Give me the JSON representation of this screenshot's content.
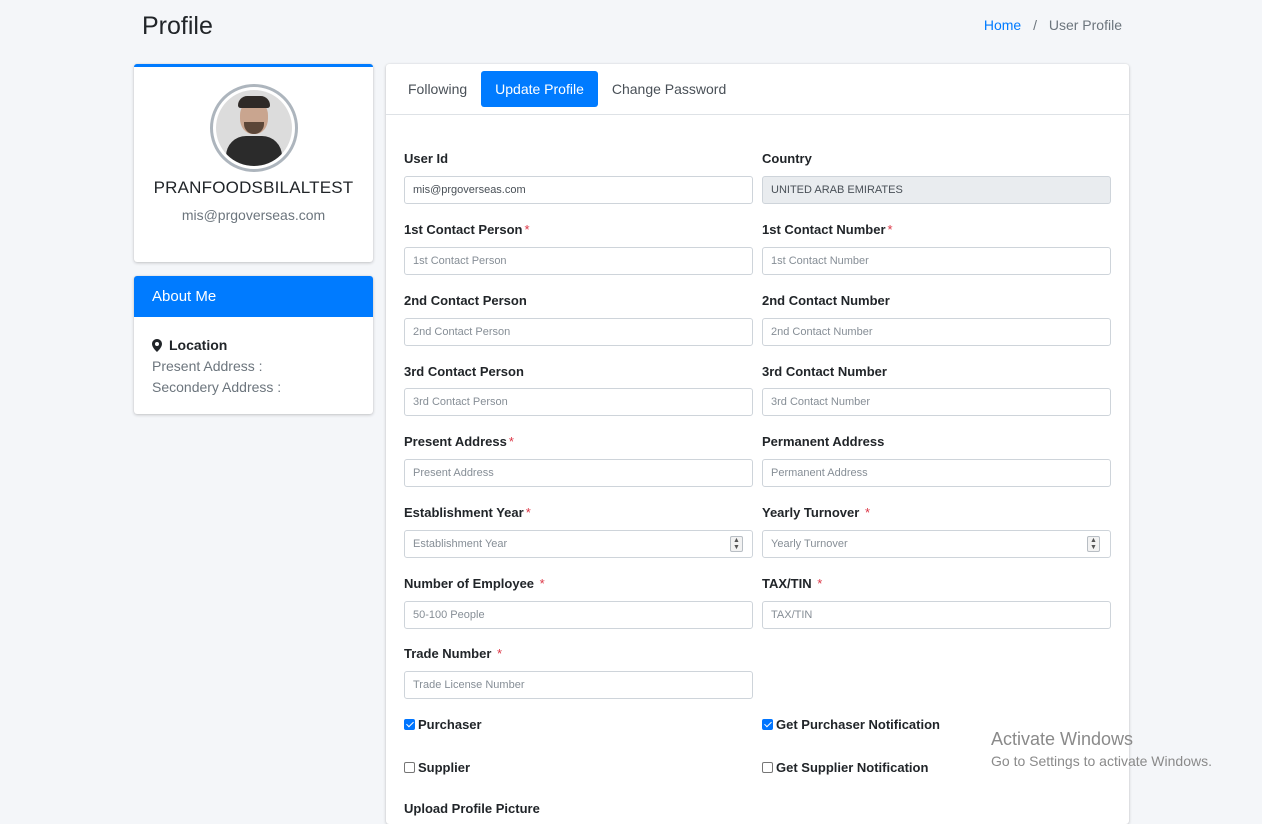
{
  "header": {
    "title": "Profile",
    "breadcrumb": {
      "home": "Home",
      "separator": "/",
      "current": "User Profile"
    }
  },
  "profile": {
    "name": "PRANFOODSBILALTEST",
    "email": "mis@prgoverseas.com"
  },
  "about": {
    "title": "About Me",
    "location_label": "Location",
    "present_address": "Present Address :",
    "secondary_address": "Secondery Address :"
  },
  "tabs": [
    {
      "label": "Following"
    },
    {
      "label": "Update Profile",
      "active": true
    },
    {
      "label": "Change Password"
    }
  ],
  "form": {
    "user_id": {
      "label": "User Id",
      "value": "mis@prgoverseas.com"
    },
    "country": {
      "label": "Country",
      "value": "UNITED ARAB EMIRATES"
    },
    "contact1_person": {
      "label": "1st Contact Person",
      "placeholder": "1st Contact Person",
      "required": "*"
    },
    "contact1_number": {
      "label": "1st Contact Number",
      "placeholder": "1st Contact Number",
      "required": "*"
    },
    "contact2_person": {
      "label": "2nd Contact Person",
      "placeholder": "2nd Contact Person"
    },
    "contact2_number": {
      "label": "2nd Contact Number",
      "placeholder": "2nd Contact Number"
    },
    "contact3_person": {
      "label": "3rd Contact Person",
      "placeholder": "3rd Contact Person"
    },
    "contact3_number": {
      "label": "3rd Contact Number",
      "placeholder": "3rd Contact Number"
    },
    "present_address": {
      "label": "Present Address",
      "placeholder": "Present Address",
      "required": "*"
    },
    "permanent_address": {
      "label": "Permanent Address",
      "placeholder": "Permanent Address"
    },
    "establishment_year": {
      "label": "Establishment Year",
      "placeholder": "Establishment Year",
      "required": "*"
    },
    "yearly_turnover": {
      "label": "Yearly Turnover",
      "placeholder": "Yearly Turnover",
      "required": "*"
    },
    "employee_count": {
      "label": "Number of Employee",
      "placeholder": "50-100 People",
      "required": "*"
    },
    "tax_tin": {
      "label": "TAX/TIN",
      "placeholder": "TAX/TIN",
      "required": "*"
    },
    "trade_number": {
      "label": "Trade Number",
      "placeholder": "Trade License Number",
      "required": "*"
    },
    "purchaser": {
      "label": "Purchaser",
      "checked": true
    },
    "purchaser_notification": {
      "label": "Get Purchaser Notification",
      "checked": true
    },
    "supplier": {
      "label": "Supplier",
      "checked": false
    },
    "supplier_notification": {
      "label": "Get Supplier Notification",
      "checked": false
    },
    "upload_picture_label": "Upload Profile Picture"
  },
  "watermark": {
    "line1": "Activate Windows",
    "line2": "Go to Settings to activate Windows."
  },
  "colors": {
    "primary": "#007bff",
    "required": "#dc3545",
    "background": "#f4f6f9"
  }
}
